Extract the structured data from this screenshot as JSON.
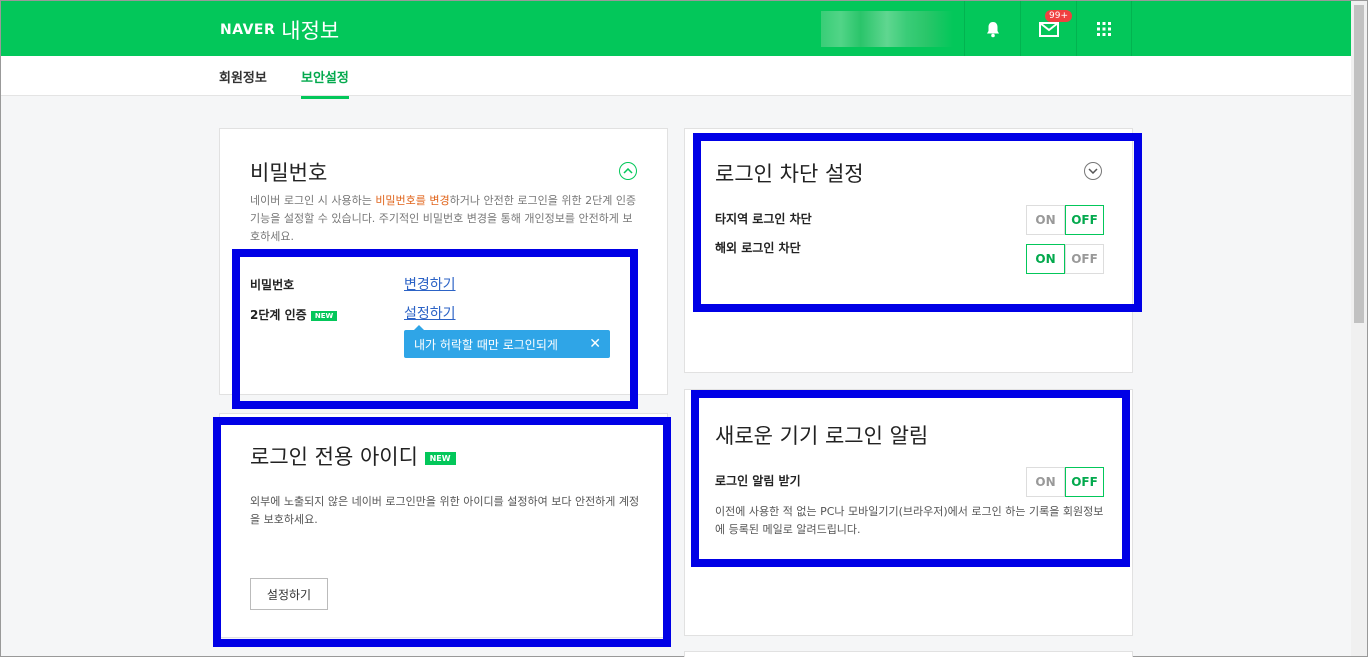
{
  "header": {
    "brand": "NAVER",
    "title": "내정보",
    "mail_badge": "99+"
  },
  "tabs": [
    {
      "label": "회원정보"
    },
    {
      "label": "보안설정"
    }
  ],
  "password_card": {
    "title": "비밀번호",
    "desc_pre": "네이버 로그인 시 사용하는 ",
    "desc_hl": "비밀번호를 변경",
    "desc_post": "하거나 안전한 로그인을 위한 2단계 인증 기능을 설정할 수 있습니다. 주기적인 비밀번호 변경을 통해 개인정보를 안전하게 보호하세요.",
    "row1_label": "비밀번호",
    "row1_link": "변경하기",
    "row2_label": "2단계 인증",
    "row2_badge": "NEW",
    "row2_link": "설정하기",
    "tooltip": "내가 허락할 때만 로그인되게"
  },
  "login_id_card": {
    "title": "로그인 전용 아이디",
    "badge": "NEW",
    "desc": "외부에 노출되지 않은 네이버 로그인만을 위한 아이디를 설정하여 보다 안전하게 계정을 보호하세요.",
    "button": "설정하기"
  },
  "block_card": {
    "title": "로그인 차단 설정",
    "row1_label": "타지역 로그인 차단",
    "row2_label": "해외 로그인 차단",
    "on": "ON",
    "off": "OFF"
  },
  "alert_card": {
    "title": "새로운 기기 로그인 알림",
    "row_label": "로그인 알림 받기",
    "on": "ON",
    "off": "OFF",
    "desc": "이전에 사용한 적 없는 PC나 모바일기기(브라우저)에서 로그인 하는 기록을 회원정보에 등록된 메일로 알려드립니다."
  },
  "colors": {
    "brand": "#03c75a",
    "annotation": "#0000e6",
    "link": "#2c63c6",
    "tooltip": "#2fa5e7"
  },
  "toggles": {
    "region_block": "OFF",
    "overseas_block": "ON",
    "new_device_alert": "OFF"
  }
}
